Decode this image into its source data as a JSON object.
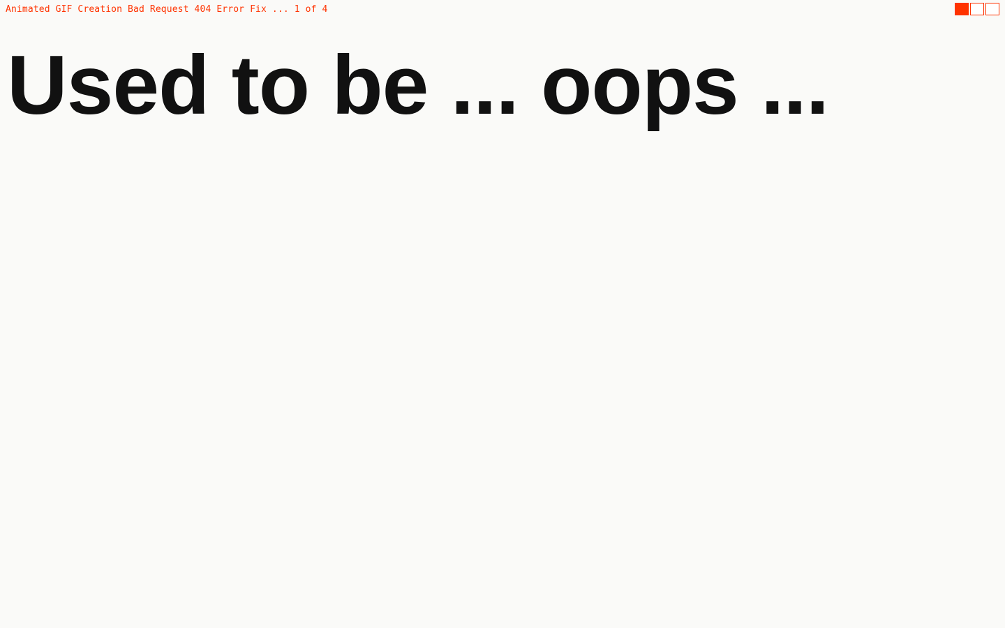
{
  "topbar": {
    "title": "Animated GIF Creation Bad Request 404 Error Fix ... 1 of 4"
  },
  "progress": {
    "total": 3,
    "filled": 1,
    "blocks": [
      {
        "filled": true
      },
      {
        "filled": false
      },
      {
        "filled": false
      }
    ]
  },
  "main": {
    "heading": "Used to be ... oops ..."
  }
}
